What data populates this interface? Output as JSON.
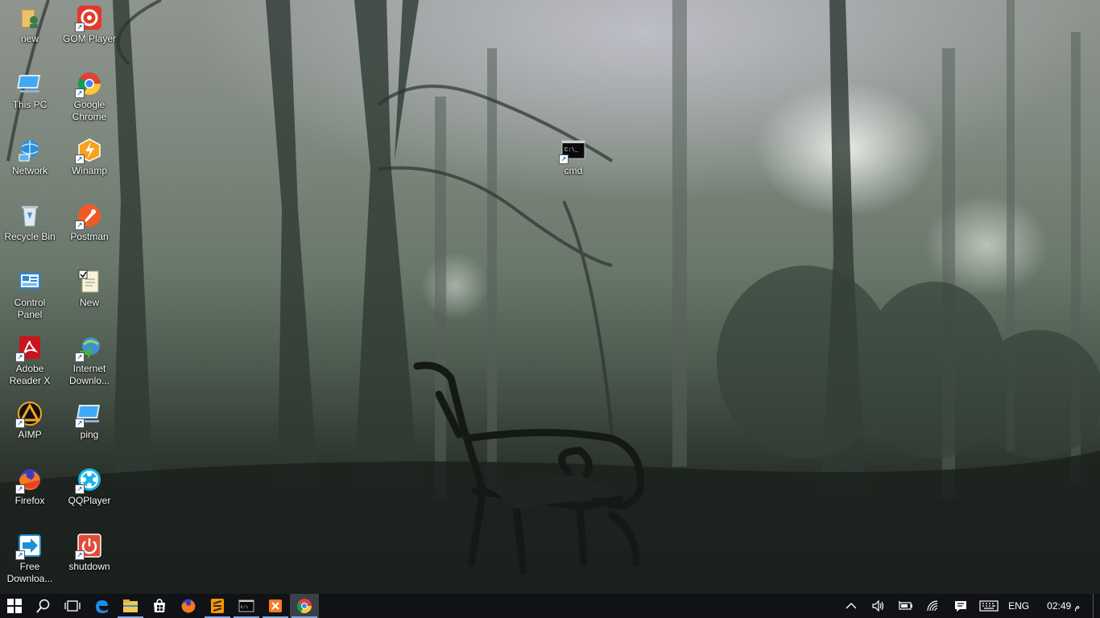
{
  "desktop_icons": [
    {
      "label": "new",
      "icon": "folder-user-icon"
    },
    {
      "label": "GOM Player",
      "icon": "gom-player-icon"
    },
    {
      "label": "This PC",
      "icon": "this-pc-icon"
    },
    {
      "label": "Google Chrome",
      "icon": "chrome-icon"
    },
    {
      "label": "Network",
      "icon": "network-icon"
    },
    {
      "label": "Winamp",
      "icon": "winamp-icon"
    },
    {
      "label": "Recycle Bin",
      "icon": "recycle-bin-icon"
    },
    {
      "label": "Postman",
      "icon": "postman-icon"
    },
    {
      "label": "Control Panel",
      "icon": "control-panel-icon"
    },
    {
      "label": "New",
      "icon": "text-document-icon"
    },
    {
      "label": "Adobe Reader X",
      "icon": "adobe-reader-icon"
    },
    {
      "label": "Internet Downlo...",
      "icon": "internet-download-manager-icon"
    },
    {
      "label": "AIMP",
      "icon": "aimp-icon"
    },
    {
      "label": "ping",
      "icon": "ping-shortcut-icon"
    },
    {
      "label": "Firefox",
      "icon": "firefox-icon"
    },
    {
      "label": "QQPlayer",
      "icon": "qqplayer-icon"
    },
    {
      "label": "Free Downloa...",
      "icon": "free-download-manager-icon"
    },
    {
      "label": "shutdown",
      "icon": "shutdown-icon"
    },
    {
      "label": "cmd",
      "icon": "cmd-icon"
    }
  ],
  "taskbar": {
    "buttons": [
      {
        "name": "start-button",
        "icon": "windows-logo-icon"
      },
      {
        "name": "search-button",
        "icon": "search-icon"
      },
      {
        "name": "task-view-button",
        "icon": "task-view-icon"
      },
      {
        "name": "taskbar-edge",
        "icon": "edge-icon"
      },
      {
        "name": "taskbar-file-explorer",
        "icon": "folder-icon"
      },
      {
        "name": "taskbar-store",
        "icon": "store-icon"
      },
      {
        "name": "taskbar-firefox",
        "icon": "firefox-icon"
      },
      {
        "name": "taskbar-sublime",
        "icon": "sublime-text-icon"
      },
      {
        "name": "taskbar-cmd",
        "icon": "cmd-icon"
      },
      {
        "name": "taskbar-xampp",
        "icon": "xampp-icon"
      },
      {
        "name": "taskbar-chrome",
        "icon": "chrome-icon"
      }
    ],
    "tray": {
      "language": "ENG",
      "time": "02:49",
      "ampm": "م"
    }
  },
  "colors": {
    "taskbar_bg": "#101216",
    "active_indicator": "#7fa9e6"
  }
}
